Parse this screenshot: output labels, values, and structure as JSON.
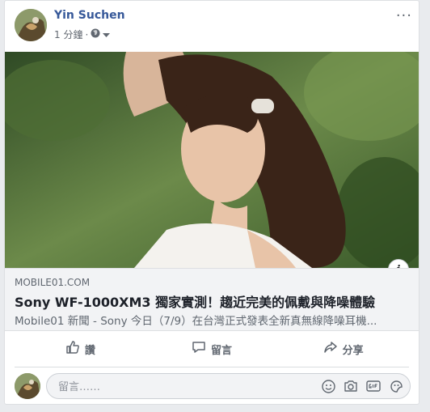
{
  "post": {
    "author": "Yin Suchen",
    "time": "1 分鐘",
    "separator": "·",
    "more": "···"
  },
  "link": {
    "domain": "MOBILE01.COM",
    "title": "Sony WF-1000XM3 獨家實測！趨近完美的佩戴與降噪體驗",
    "description": "Mobile01 新聞 - Sony 今日（7/9）在台灣正式發表全新真無線降噪耳機...",
    "info": "i"
  },
  "actions": {
    "like": "讚",
    "comment": "留言",
    "share": "分享"
  },
  "comment": {
    "placeholder": "留言……"
  },
  "icons": {
    "privacy": "globe-icon",
    "like": "thumbs-up-icon",
    "comment": "speech-bubble-icon",
    "share": "share-arrow-icon",
    "emoji": "smiley-icon",
    "camera": "camera-icon",
    "gif": "gif-icon",
    "sticker": "sticker-icon"
  }
}
